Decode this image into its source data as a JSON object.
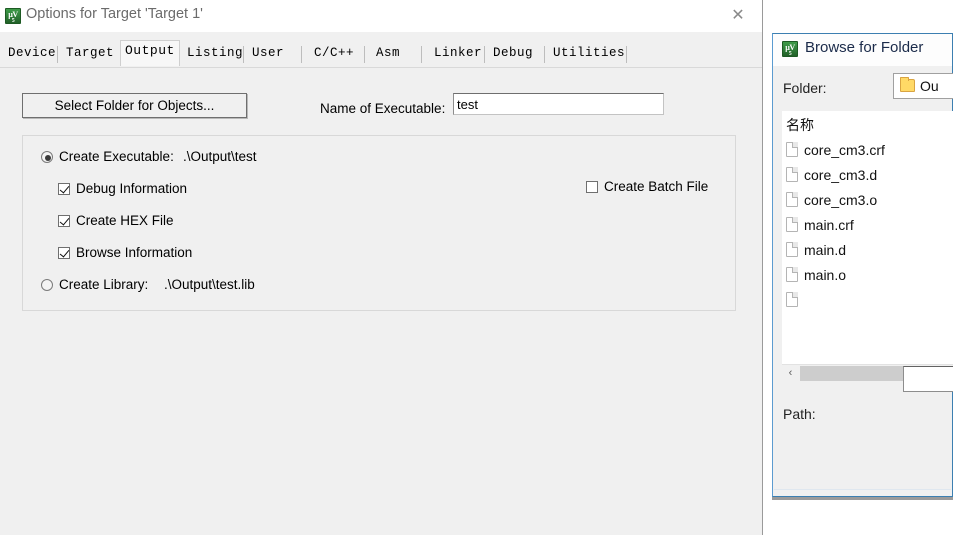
{
  "options_dialog": {
    "title": "Options for Target 'Target 1'",
    "icon": "uvision-logo-icon",
    "close_label": "✕",
    "tabs": [
      {
        "label": "Device",
        "selected": false
      },
      {
        "label": "Target",
        "selected": false
      },
      {
        "label": "Output",
        "selected": true
      },
      {
        "label": "Listing",
        "selected": false
      },
      {
        "label": "User",
        "selected": false
      },
      {
        "label": "C/C++",
        "selected": false
      },
      {
        "label": "Asm",
        "selected": false
      },
      {
        "label": "Linker",
        "selected": false
      },
      {
        "label": "Debug",
        "selected": false
      },
      {
        "label": "Utilities",
        "selected": false
      }
    ],
    "output_tab": {
      "select_folder_button": "Select Folder for Objects...",
      "executable_name_label": "Name of Executable:",
      "executable_name_value": "test",
      "create_executable": {
        "label": "Create Executable:",
        "path": ".\\Output\\test",
        "checked": true
      },
      "debug_information": {
        "label": "Debug Information",
        "checked": true
      },
      "create_hex_file": {
        "label": "Create HEX File",
        "checked": true
      },
      "browse_information": {
        "label": "Browse Information",
        "checked": true
      },
      "create_library": {
        "label": "Create Library:",
        "path": ".\\Output\\test.lib",
        "checked": false
      },
      "create_batch_file": {
        "label": "Create Batch File",
        "checked": false
      }
    }
  },
  "browse_dialog": {
    "title": "Browse for Folder",
    "icon": "uvision-logo-icon",
    "folder_label": "Folder:",
    "folder_value": "Ou",
    "list_header": "名称",
    "files": [
      {
        "name": "core_cm3.crf"
      },
      {
        "name": "core_cm3.d"
      },
      {
        "name": "core_cm3.o"
      },
      {
        "name": "main.crf"
      },
      {
        "name": "main.d"
      },
      {
        "name": "main.o"
      }
    ],
    "scroll_left_label": "‹",
    "path_label": "Path:",
    "path_value": ""
  },
  "colors": {
    "dialog_background": "#f0f0f0",
    "titlebar_background": "#ffffff",
    "browse_border": "#3c7fb1",
    "folder_icon": "#ffd966",
    "uvision_green": "#2f7d38"
  }
}
